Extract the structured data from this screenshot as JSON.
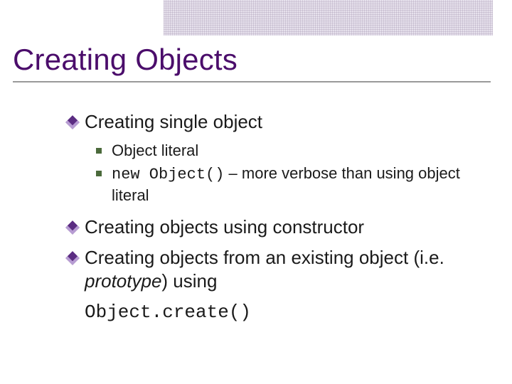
{
  "title": "Creating Objects",
  "bullets": {
    "b1": "Creating single object",
    "b1_sub1": "Object literal",
    "b1_sub2_code": "new Object()",
    "b1_sub2_rest": " – more verbose than using object literal",
    "b2": "Creating objects using constructor",
    "b3_a": "Creating objects from an existing object (i.e. ",
    "b3_italic": "prototype",
    "b3_b": ") using",
    "b3_code": "Object.create()"
  }
}
